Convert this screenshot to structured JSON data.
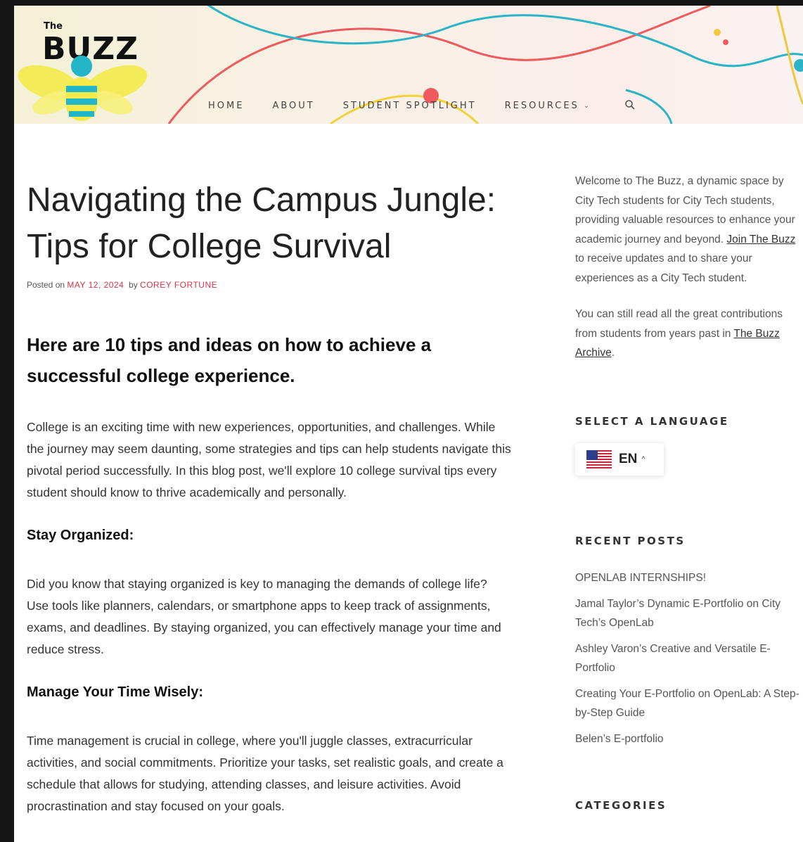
{
  "site": {
    "logo_small": "The",
    "logo_word": "BUZZ"
  },
  "nav": {
    "items": [
      "HOME",
      "ABOUT",
      "STUDENT SPOTLIGHT",
      "RESOURCES"
    ],
    "resources_chevron": "⌄",
    "search_icon": "search-icon"
  },
  "post": {
    "title_line1": "Navigating the Campus Jungle:",
    "title_line2": "Tips for College Survival",
    "posted_on": "Posted on",
    "date": "MAY 12, 2024",
    "by": "by",
    "author": "COREY FORTUNE",
    "subheading_line1": "Here are 10 tips and ideas on how to achieve a",
    "subheading_line2": "successful college experience.",
    "intro": "College is an exciting time with new experiences, opportunities, and challenges. While the journey may seem daunting, some strategies and tips can help students navigate this pivotal period successfully. In this blog post, we'll explore 10 college survival tips every student should know to thrive academically and personally.",
    "section1_title": "Stay Organized:",
    "section1_body": "Did you know that staying organized is key to managing the demands of college life? Use tools like planners, calendars, or smartphone apps to keep track of assignments, exams, and deadlines. By staying organized, you can effectively manage your time and reduce stress.",
    "section2_title": "Manage Your Time Wisely:",
    "section2_body": "Time management is crucial in college, where you'll juggle classes, extracurricular activities, and social commitments. Prioritize your tasks, set realistic goals, and create a schedule that allows for studying, attending classes, and leisure activities. Avoid procrastination and stay focused on your goals."
  },
  "sidebar": {
    "welcome_text": "Welcome to The Buzz, a dynamic space by City Tech students for City Tech students, providing valuable resources to enhance your academic journey and beyond. ",
    "join_link": "Join The Buzz",
    "welcome_text_end": " to receive updates and to share your experiences as a City Tech student.",
    "archive_text": "You can still read all the great contributions from students from years past in ",
    "archive_link": "The Buzz Archive",
    "archive_end": ".",
    "language_title": "SELECT A LANGUAGE",
    "language_code": "EN",
    "language_caret": "^",
    "flag_icon": "us-flag-icon",
    "recent_title": "RECENT POSTS",
    "recent_posts": [
      "OPENLAB INTERNSHIPS!",
      "Jamal Taylor’s Dynamic E-Portfolio on City Tech’s OpenLab",
      "Ashley Varon’s Creative and Versatile E-Portfolio",
      "Creating Your E-Portfolio on OpenLab: A Step-by-Step Guide",
      "Belen’s E-portfolio"
    ],
    "categories_title": "CATEGORIES"
  },
  "colors": {
    "accent": "#d0334d",
    "bee_yellow": "#f4ea4a",
    "bee_teal": "#22b6c8",
    "curve_red": "#ef5a5f",
    "curve_teal": "#2bb4c6"
  }
}
